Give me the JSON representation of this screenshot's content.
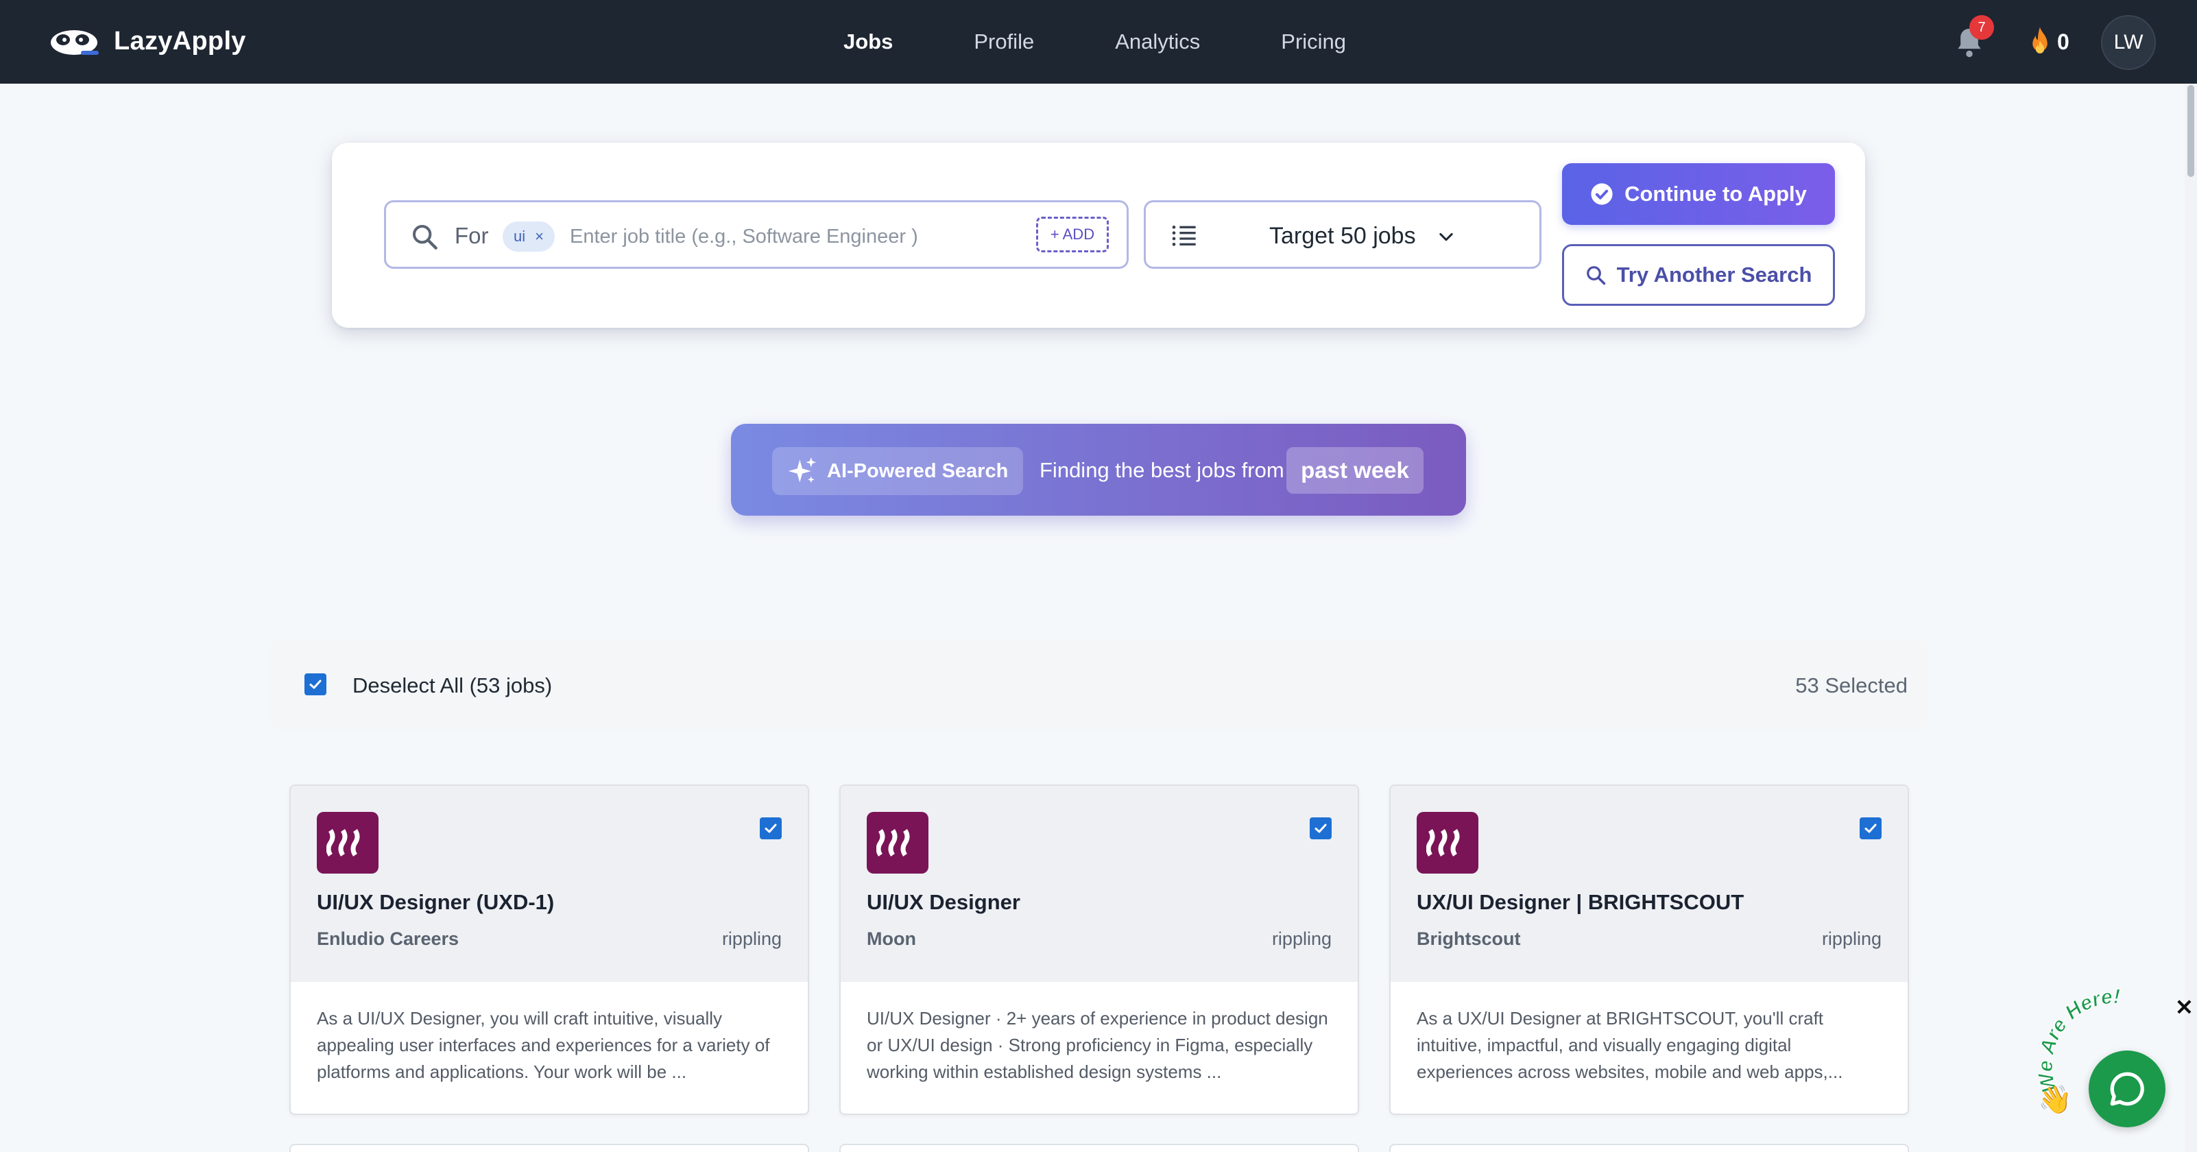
{
  "app": {
    "name": "LazyApply"
  },
  "nav": {
    "links": [
      {
        "label": "Jobs",
        "active": true
      },
      {
        "label": "Profile",
        "active": false
      },
      {
        "label": "Analytics",
        "active": false
      },
      {
        "label": "Pricing",
        "active": false
      }
    ],
    "notifications_count": "7",
    "streak_count": "0",
    "user_initials": "LW"
  },
  "search": {
    "for_label": "For",
    "chip_label": "ui",
    "chip_remove": "×",
    "placeholder": "Enter job title (e.g., Software Engineer )",
    "add_label": "+ ADD",
    "target_label": "Target 50 jobs",
    "continue_label": "Continue to Apply",
    "another_label": "Try Another Search"
  },
  "ai_banner": {
    "pill_label": "AI-Powered Search",
    "text": "Finding the best jobs from",
    "period": "past week"
  },
  "selection": {
    "label": "Deselect All (53 jobs)",
    "count": "53 Selected",
    "all_checked": true
  },
  "jobs": [
    {
      "title": "UI/UX Designer (UXD-1)",
      "company": "Enludio Careers",
      "source": "rippling",
      "description": "As a UI/UX Designer, you will craft intuitive, visually appealing user interfaces and experiences for a variety of platforms and applications. Your work will be ...",
      "checked": true
    },
    {
      "title": "UI/UX Designer",
      "company": "Moon",
      "source": "rippling",
      "description": "UI/UX Designer · 2+ years of experience in product design or UX/UI design · Strong proficiency in Figma, especially working within established design systems ...",
      "checked": true
    },
    {
      "title": "UX/UI Designer | BRIGHTSCOUT",
      "company": "Brightscout",
      "source": "rippling",
      "description": "As a UX/UI Designer at BRIGHTSCOUT, you'll craft intuitive, impactful, and visually engaging digital experiences across websites, mobile and web apps,...",
      "checked": true
    }
  ],
  "chat_widget": {
    "tagline": "We Are Here!",
    "close": "✕"
  },
  "colors": {
    "navbar": "#1e2632",
    "accent": "#5a63e6",
    "checkbox": "#1d6fd4",
    "logo_tile": "#7a1456",
    "chat": "#1b9a4b"
  },
  "icons": {
    "brand": "panda-logo-icon",
    "bell": "bell-icon",
    "streak": "flame-icon",
    "search": "search-icon",
    "list": "list-icon",
    "dropdown": "chevron-down-icon",
    "continue": "check-circle-icon",
    "ai": "sparkle-icon",
    "chat": "chat-bubble-icon"
  }
}
